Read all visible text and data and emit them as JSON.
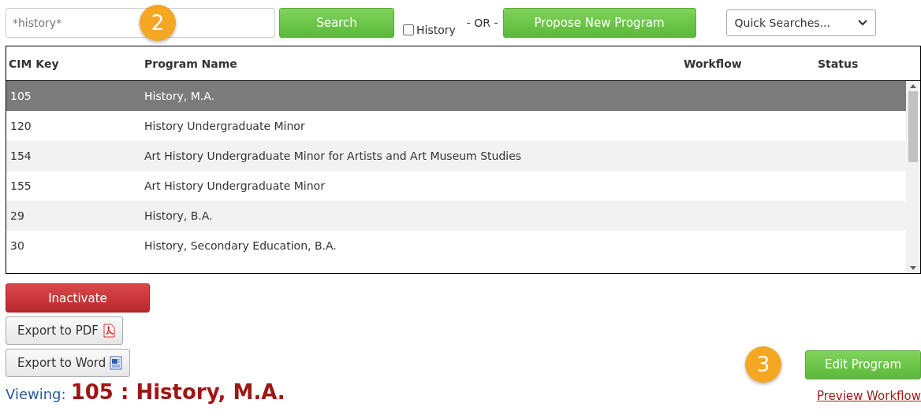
{
  "search": {
    "value": "*history*",
    "button": "Search",
    "history_checkbox": {
      "label": "History",
      "checked": false
    },
    "or_text": "- OR -",
    "propose_button": "Propose New Program",
    "quick_searches": "Quick Searches..."
  },
  "callouts": [
    "2",
    "3"
  ],
  "table": {
    "columns": [
      "CIM Key",
      "Program Name",
      "Workflow",
      "Status"
    ],
    "rows": [
      {
        "cells": [
          "105",
          "History, M.A."
        ],
        "selected": true
      },
      {
        "cells": [
          "120",
          "History Undergraduate Minor"
        ],
        "selected": false
      },
      {
        "cells": [
          "154",
          "Art History Undergraduate Minor for Artists and Art Museum Studies"
        ],
        "selected": false
      },
      {
        "cells": [
          "155",
          "Art History Undergraduate Minor"
        ],
        "selected": false
      },
      {
        "cells": [
          "29",
          "History, B.A."
        ],
        "selected": false
      },
      {
        "cells": [
          "30",
          "History, Secondary Education, B.A."
        ],
        "selected": false
      }
    ]
  },
  "actions": {
    "inactivate": "Inactivate",
    "export_pdf": "Export to PDF",
    "export_word": "Export to Word",
    "edit": "Edit Program",
    "preview": "Preview Workflow"
  },
  "viewing": {
    "label": "Viewing:",
    "title": "105 : History, M.A."
  }
}
